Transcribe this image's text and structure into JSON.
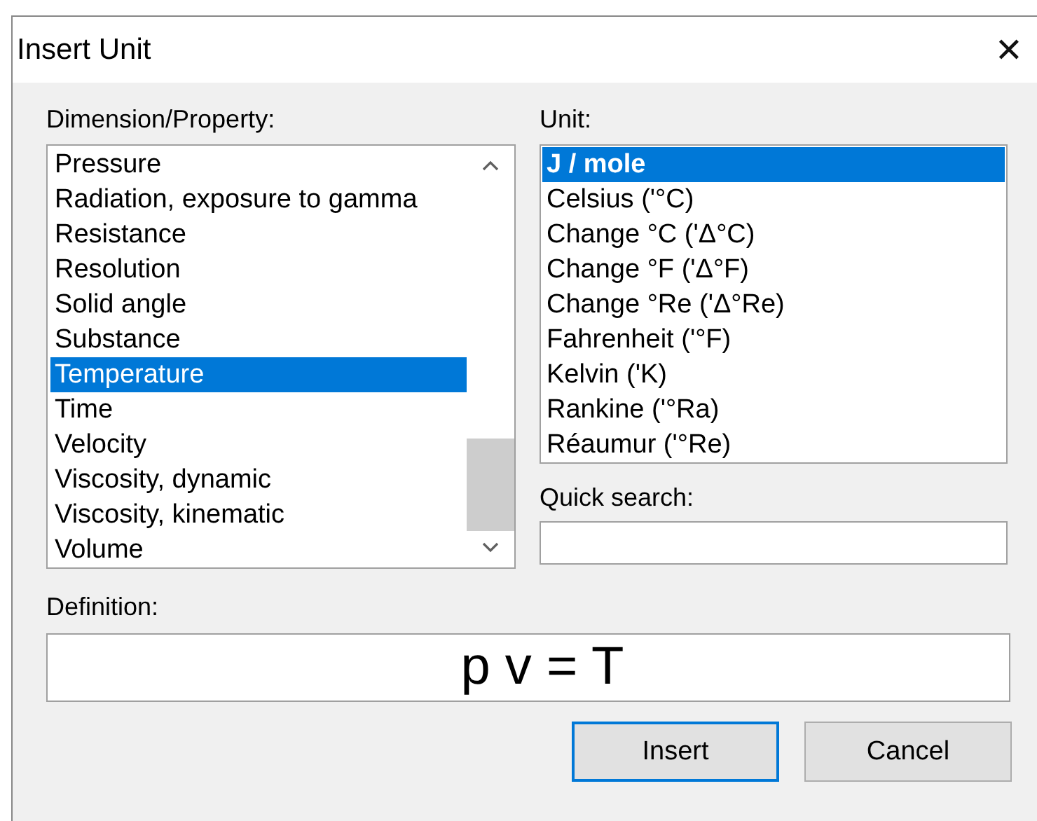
{
  "window": {
    "title": "Insert Unit",
    "close": "✕"
  },
  "dimension": {
    "label": "Dimension/Property:",
    "items": [
      {
        "label": "Pressure",
        "selected": false
      },
      {
        "label": "Radiation, exposure to gamma",
        "selected": false
      },
      {
        "label": "Resistance",
        "selected": false
      },
      {
        "label": "Resolution",
        "selected": false
      },
      {
        "label": "Solid angle",
        "selected": false
      },
      {
        "label": "Substance",
        "selected": false
      },
      {
        "label": "Temperature",
        "selected": true
      },
      {
        "label": "Time",
        "selected": false
      },
      {
        "label": "Velocity",
        "selected": false
      },
      {
        "label": "Viscosity, dynamic",
        "selected": false
      },
      {
        "label": "Viscosity, kinematic",
        "selected": false
      },
      {
        "label": "Volume",
        "selected": false
      }
    ]
  },
  "unit": {
    "label": "Unit:",
    "items": [
      {
        "label": "J / mole",
        "selected": true
      },
      {
        "label": "Celsius ('°C)",
        "selected": false
      },
      {
        "label": "Change °C ('Δ°C)",
        "selected": false
      },
      {
        "label": "Change °F ('Δ°F)",
        "selected": false
      },
      {
        "label": "Change °Re ('Δ°Re)",
        "selected": false
      },
      {
        "label": "Fahrenheit ('°F)",
        "selected": false
      },
      {
        "label": "Kelvin ('K)",
        "selected": false
      },
      {
        "label": "Rankine ('°Ra)",
        "selected": false
      },
      {
        "label": "Réaumur ('°Re)",
        "selected": false
      }
    ]
  },
  "quick_search": {
    "label": "Quick search:"
  },
  "definition": {
    "label": "Definition:",
    "value": "p v = T"
  },
  "buttons": [
    {
      "label": "Insert",
      "default": true
    },
    {
      "label": "Cancel",
      "default": false
    }
  ]
}
